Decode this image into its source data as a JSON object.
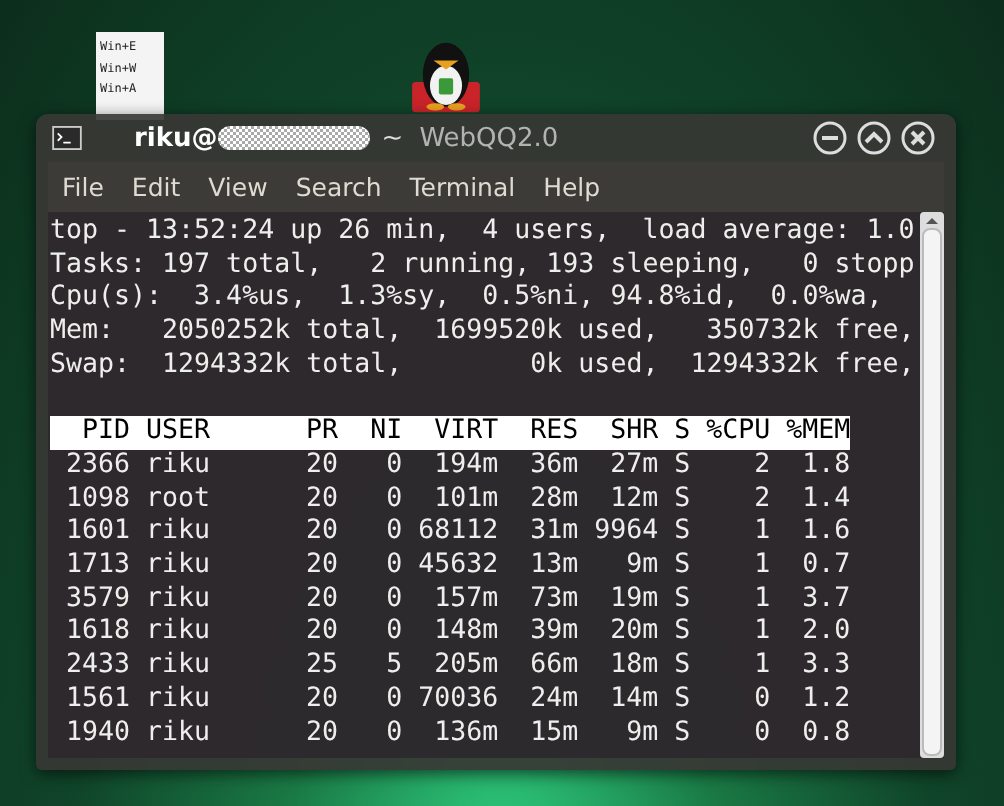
{
  "desktop": {
    "file_icon_lines": [
      "Win+E",
      "Win+W",
      "Win+A"
    ],
    "app_icon_label": "WebQQ2.0"
  },
  "window": {
    "title": "riku@",
    "title_suffix": "~"
  },
  "menu": [
    "File",
    "Edit",
    "View",
    "Search",
    "Terminal",
    "Help"
  ],
  "summary_lines": [
    "top - 13:52:24 up 26 min,  4 users,  load average: 1.0",
    "Tasks: 197 total,   2 running, 193 sleeping,   0 stopp",
    "Cpu(s):  3.4%us,  1.3%sy,  0.5%ni, 94.8%id,  0.0%wa,",
    "Mem:   2050252k total,  1699520k used,   350732k free,",
    "Swap:  1294332k total,        0k used,  1294332k free,"
  ],
  "table": {
    "columns": [
      "PID",
      "USER",
      "PR",
      "NI",
      "VIRT",
      "RES",
      "SHR",
      "S",
      "%CPU",
      "%MEM"
    ],
    "rows": [
      [
        "2366",
        "riku",
        "20",
        "0",
        "194m",
        "36m",
        "27m",
        "S",
        "2",
        "1.8"
      ],
      [
        "1098",
        "root",
        "20",
        "0",
        "101m",
        "28m",
        "12m",
        "S",
        "2",
        "1.4"
      ],
      [
        "1601",
        "riku",
        "20",
        "0",
        "68112",
        "31m",
        "9964",
        "S",
        "1",
        "1.6"
      ],
      [
        "1713",
        "riku",
        "20",
        "0",
        "45632",
        "13m",
        "9m",
        "S",
        "1",
        "0.7"
      ],
      [
        "3579",
        "riku",
        "20",
        "0",
        "157m",
        "73m",
        "19m",
        "S",
        "1",
        "3.7"
      ],
      [
        "1618",
        "riku",
        "20",
        "0",
        "148m",
        "39m",
        "20m",
        "S",
        "1",
        "2.0"
      ],
      [
        "2433",
        "riku",
        "25",
        "5",
        "205m",
        "66m",
        "18m",
        "S",
        "1",
        "3.3"
      ],
      [
        "1561",
        "riku",
        "20",
        "0",
        "70036",
        "24m",
        "14m",
        "S",
        "0",
        "1.2"
      ],
      [
        "1940",
        "riku",
        "20",
        "0",
        "136m",
        "15m",
        "9m",
        "S",
        "0",
        "0.8"
      ]
    ]
  }
}
